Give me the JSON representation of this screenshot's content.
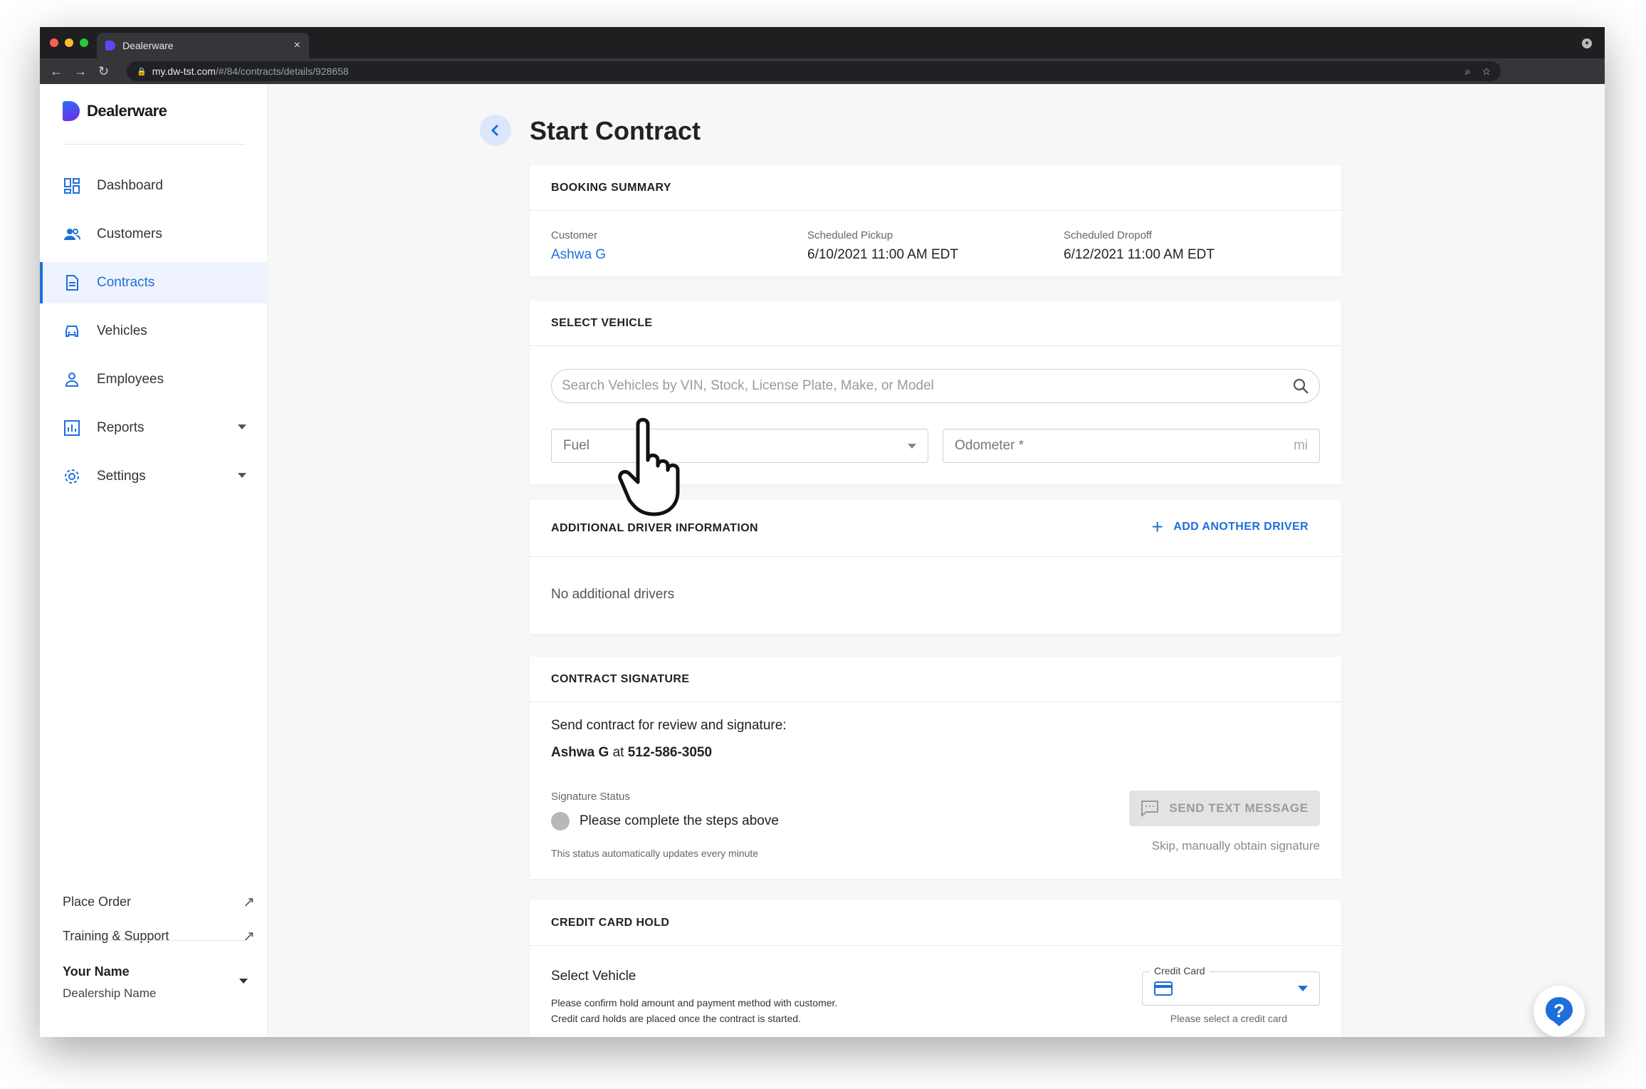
{
  "browser": {
    "tab_title": "Dealerware",
    "tab_close": "×",
    "url_host": "my.dw-tst.com",
    "url_path": "/#/84/contracts/details/928658",
    "back_glyph": "←",
    "forward_glyph": "→",
    "reload_glyph": "↻",
    "zoom_glyph": "⌕",
    "star_glyph": "☆",
    "lock_glyph": "🔒"
  },
  "brand": {
    "name": "Dealerware"
  },
  "sidebar": {
    "items": [
      {
        "label": "Dashboard",
        "icon": "dashboard-icon"
      },
      {
        "label": "Customers",
        "icon": "people-icon"
      },
      {
        "label": "Contracts",
        "icon": "document-icon",
        "active": true
      },
      {
        "label": "Vehicles",
        "icon": "car-icon"
      },
      {
        "label": "Employees",
        "icon": "person-icon"
      },
      {
        "label": "Reports",
        "icon": "bar-chart-icon",
        "expandable": true
      },
      {
        "label": "Settings",
        "icon": "gear-icon",
        "expandable": true
      }
    ],
    "place_order": "Place Order",
    "training_support": "Training & Support",
    "external_glyph": "↗",
    "user_name": "Your Name",
    "dealership_name": "Dealership Name"
  },
  "page": {
    "title": "Start Contract"
  },
  "booking_summary": {
    "heading": "BOOKING SUMMARY",
    "customer_label": "Customer",
    "customer_value": "Ashwa G",
    "pickup_label": "Scheduled Pickup",
    "pickup_value": "6/10/2021 11:00 AM EDT",
    "dropoff_label": "Scheduled Dropoff",
    "dropoff_value": "6/12/2021 11:00 AM EDT"
  },
  "select_vehicle": {
    "heading": "SELECT VEHICLE",
    "search_placeholder": "Search Vehicles by VIN, Stock, License Plate, Make, or Model",
    "fuel_placeholder": "Fuel",
    "odometer_placeholder": "Odometer *",
    "odometer_unit": "mi"
  },
  "additional_driver": {
    "heading": "ADDITIONAL DRIVER INFORMATION",
    "add_label": "ADD ANOTHER DRIVER",
    "add_glyph": "+",
    "empty_text": "No additional drivers"
  },
  "contract_signature": {
    "heading": "CONTRACT SIGNATURE",
    "intro": "Send contract for review and signature:",
    "recipient_name": "Ashwa G",
    "recipient_at": "at",
    "recipient_phone": "512-586-3050",
    "status_label": "Signature Status",
    "status_text": "Please complete the steps above",
    "status_note": "This status automatically updates every minute",
    "send_button": "SEND TEXT MESSAGE",
    "skip_link": "Skip, manually obtain signature"
  },
  "credit_card_hold": {
    "heading": "CREDIT CARD HOLD",
    "title": "Select Vehicle",
    "line1": "Please confirm hold amount and payment method with customer.",
    "line2": "Credit card holds are placed once the contract is started.",
    "cc_label": "Credit Card",
    "cc_hint": "Please select a credit card"
  },
  "help": {
    "glyph": "?"
  },
  "colors": {
    "accent": "#1e6fd9",
    "sidebar_active_bg": "#eef3fd",
    "disabled": "#e3e3e3"
  }
}
